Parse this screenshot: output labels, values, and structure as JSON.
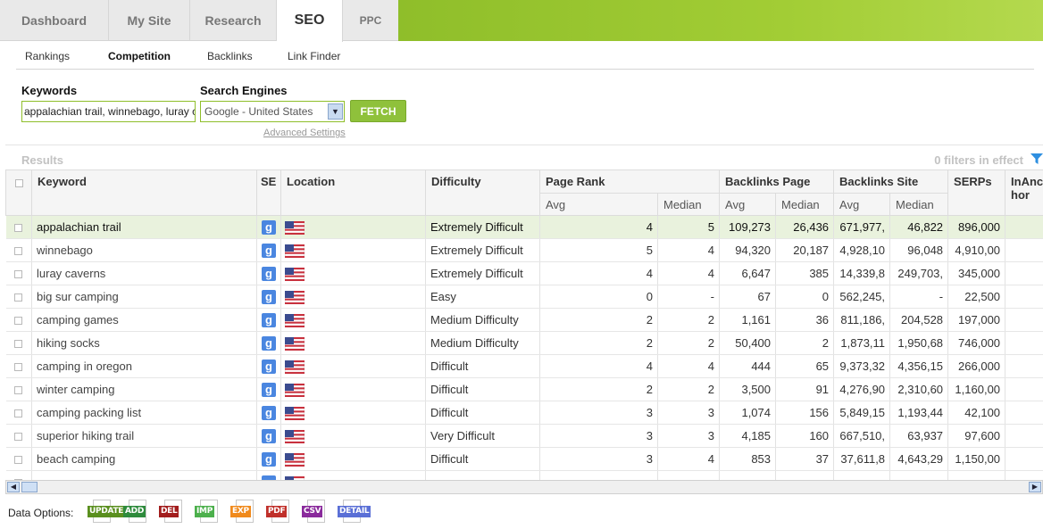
{
  "top_tabs": [
    "Dashboard",
    "My Site",
    "Research",
    "SEO",
    "PPC"
  ],
  "active_tab": "SEO",
  "sub_nav": [
    "Rankings",
    "Competition",
    "Backlinks",
    "Link Finder"
  ],
  "active_sub_nav": "Competition",
  "form": {
    "keywords_label": "Keywords",
    "keywords_value": "appalachian trail, winnebago, luray caverns",
    "engines_label": "Search Engines",
    "engine_value": "Google - United States",
    "fetch_label": "FETCH",
    "advanced_label": "Advanced Settings"
  },
  "results": {
    "label": "Results",
    "filters_text": "0 filters in effect"
  },
  "columns": {
    "keyword": "Keyword",
    "se": "SE",
    "location": "Location",
    "difficulty": "Difficulty",
    "page_rank": "Page Rank",
    "backlinks_page": "Backlinks Page",
    "backlinks_site": "Backlinks Site",
    "serps": "SERPs",
    "inanchor": "InAnchor",
    "avg": "Avg",
    "median": "Median"
  },
  "rows": [
    {
      "keyword": "appalachian trail",
      "difficulty": "Extremely Difficult",
      "pr_avg": "4",
      "pr_median": "5",
      "bp_avg": "109,273",
      "bp_median": "26,436",
      "bs_avg": "671,977,",
      "bs_median": "46,822",
      "serps": "896,000",
      "selected": true
    },
    {
      "keyword": "winnebago",
      "difficulty": "Extremely Difficult",
      "pr_avg": "5",
      "pr_median": "4",
      "bp_avg": "94,320",
      "bp_median": "20,187",
      "bs_avg": "4,928,10",
      "bs_median": "96,048",
      "serps": "4,910,00"
    },
    {
      "keyword": "luray caverns",
      "difficulty": "Extremely Difficult",
      "pr_avg": "4",
      "pr_median": "4",
      "bp_avg": "6,647",
      "bp_median": "385",
      "bs_avg": "14,339,8",
      "bs_median": "249,703,",
      "serps": "345,000"
    },
    {
      "keyword": "big sur camping",
      "difficulty": "Easy",
      "pr_avg": "0",
      "pr_median": "-",
      "bp_avg": "67",
      "bp_median": "0",
      "bs_avg": "562,245,",
      "bs_median": "-",
      "serps": "22,500"
    },
    {
      "keyword": "camping games",
      "difficulty": "Medium Difficulty",
      "pr_avg": "2",
      "pr_median": "2",
      "bp_avg": "1,161",
      "bp_median": "36",
      "bs_avg": "811,186,",
      "bs_median": "204,528",
      "serps": "197,000"
    },
    {
      "keyword": "hiking socks",
      "difficulty": "Medium Difficulty",
      "pr_avg": "2",
      "pr_median": "2",
      "bp_avg": "50,400",
      "bp_median": "2",
      "bs_avg": "1,873,11",
      "bs_median": "1,950,68",
      "serps": "746,000"
    },
    {
      "keyword": "camping in oregon",
      "difficulty": "Difficult",
      "pr_avg": "4",
      "pr_median": "4",
      "bp_avg": "444",
      "bp_median": "65",
      "bs_avg": "9,373,32",
      "bs_median": "4,356,15",
      "serps": "266,000"
    },
    {
      "keyword": "winter camping",
      "difficulty": "Difficult",
      "pr_avg": "2",
      "pr_median": "2",
      "bp_avg": "3,500",
      "bp_median": "91",
      "bs_avg": "4,276,90",
      "bs_median": "2,310,60",
      "serps": "1,160,00"
    },
    {
      "keyword": "camping packing list",
      "difficulty": "Difficult",
      "pr_avg": "3",
      "pr_median": "3",
      "bp_avg": "1,074",
      "bp_median": "156",
      "bs_avg": "5,849,15",
      "bs_median": "1,193,44",
      "serps": "42,100"
    },
    {
      "keyword": "superior hiking trail",
      "difficulty": "Very Difficult",
      "pr_avg": "3",
      "pr_median": "3",
      "bp_avg": "4,185",
      "bp_median": "160",
      "bs_avg": "667,510,",
      "bs_median": "63,937",
      "serps": "97,600"
    },
    {
      "keyword": "beach camping",
      "difficulty": "Difficult",
      "pr_avg": "3",
      "pr_median": "4",
      "bp_avg": "853",
      "bp_median": "37",
      "bs_avg": "37,611,8",
      "bs_median": "4,643,29",
      "serps": "1,150,00"
    },
    {
      "keyword": "",
      "difficulty": "",
      "pr_avg": "",
      "pr_median": "",
      "bp_avg": "",
      "bp_median": "",
      "bs_avg": "",
      "bs_median": "",
      "serps": ""
    }
  ],
  "data_options": {
    "label": "Data Options:",
    "buttons": [
      {
        "name": "update",
        "text": "UPDATE",
        "color": "#5a8f1e"
      },
      {
        "name": "add",
        "text": "ADD",
        "color": "#2e8b3c"
      },
      {
        "name": "del",
        "text": "DEL",
        "color": "#a21d1d"
      },
      {
        "name": "imp",
        "text": "IMP",
        "color": "#4cb04c"
      },
      {
        "name": "exp",
        "text": "EXP",
        "color": "#f08a1c"
      },
      {
        "name": "pdf",
        "text": "PDF",
        "color": "#c0302a"
      },
      {
        "name": "csv",
        "text": "CSV",
        "color": "#8a2a9c"
      },
      {
        "name": "detail",
        "text": "DETAIL",
        "color": "#5a6fd6"
      }
    ]
  }
}
